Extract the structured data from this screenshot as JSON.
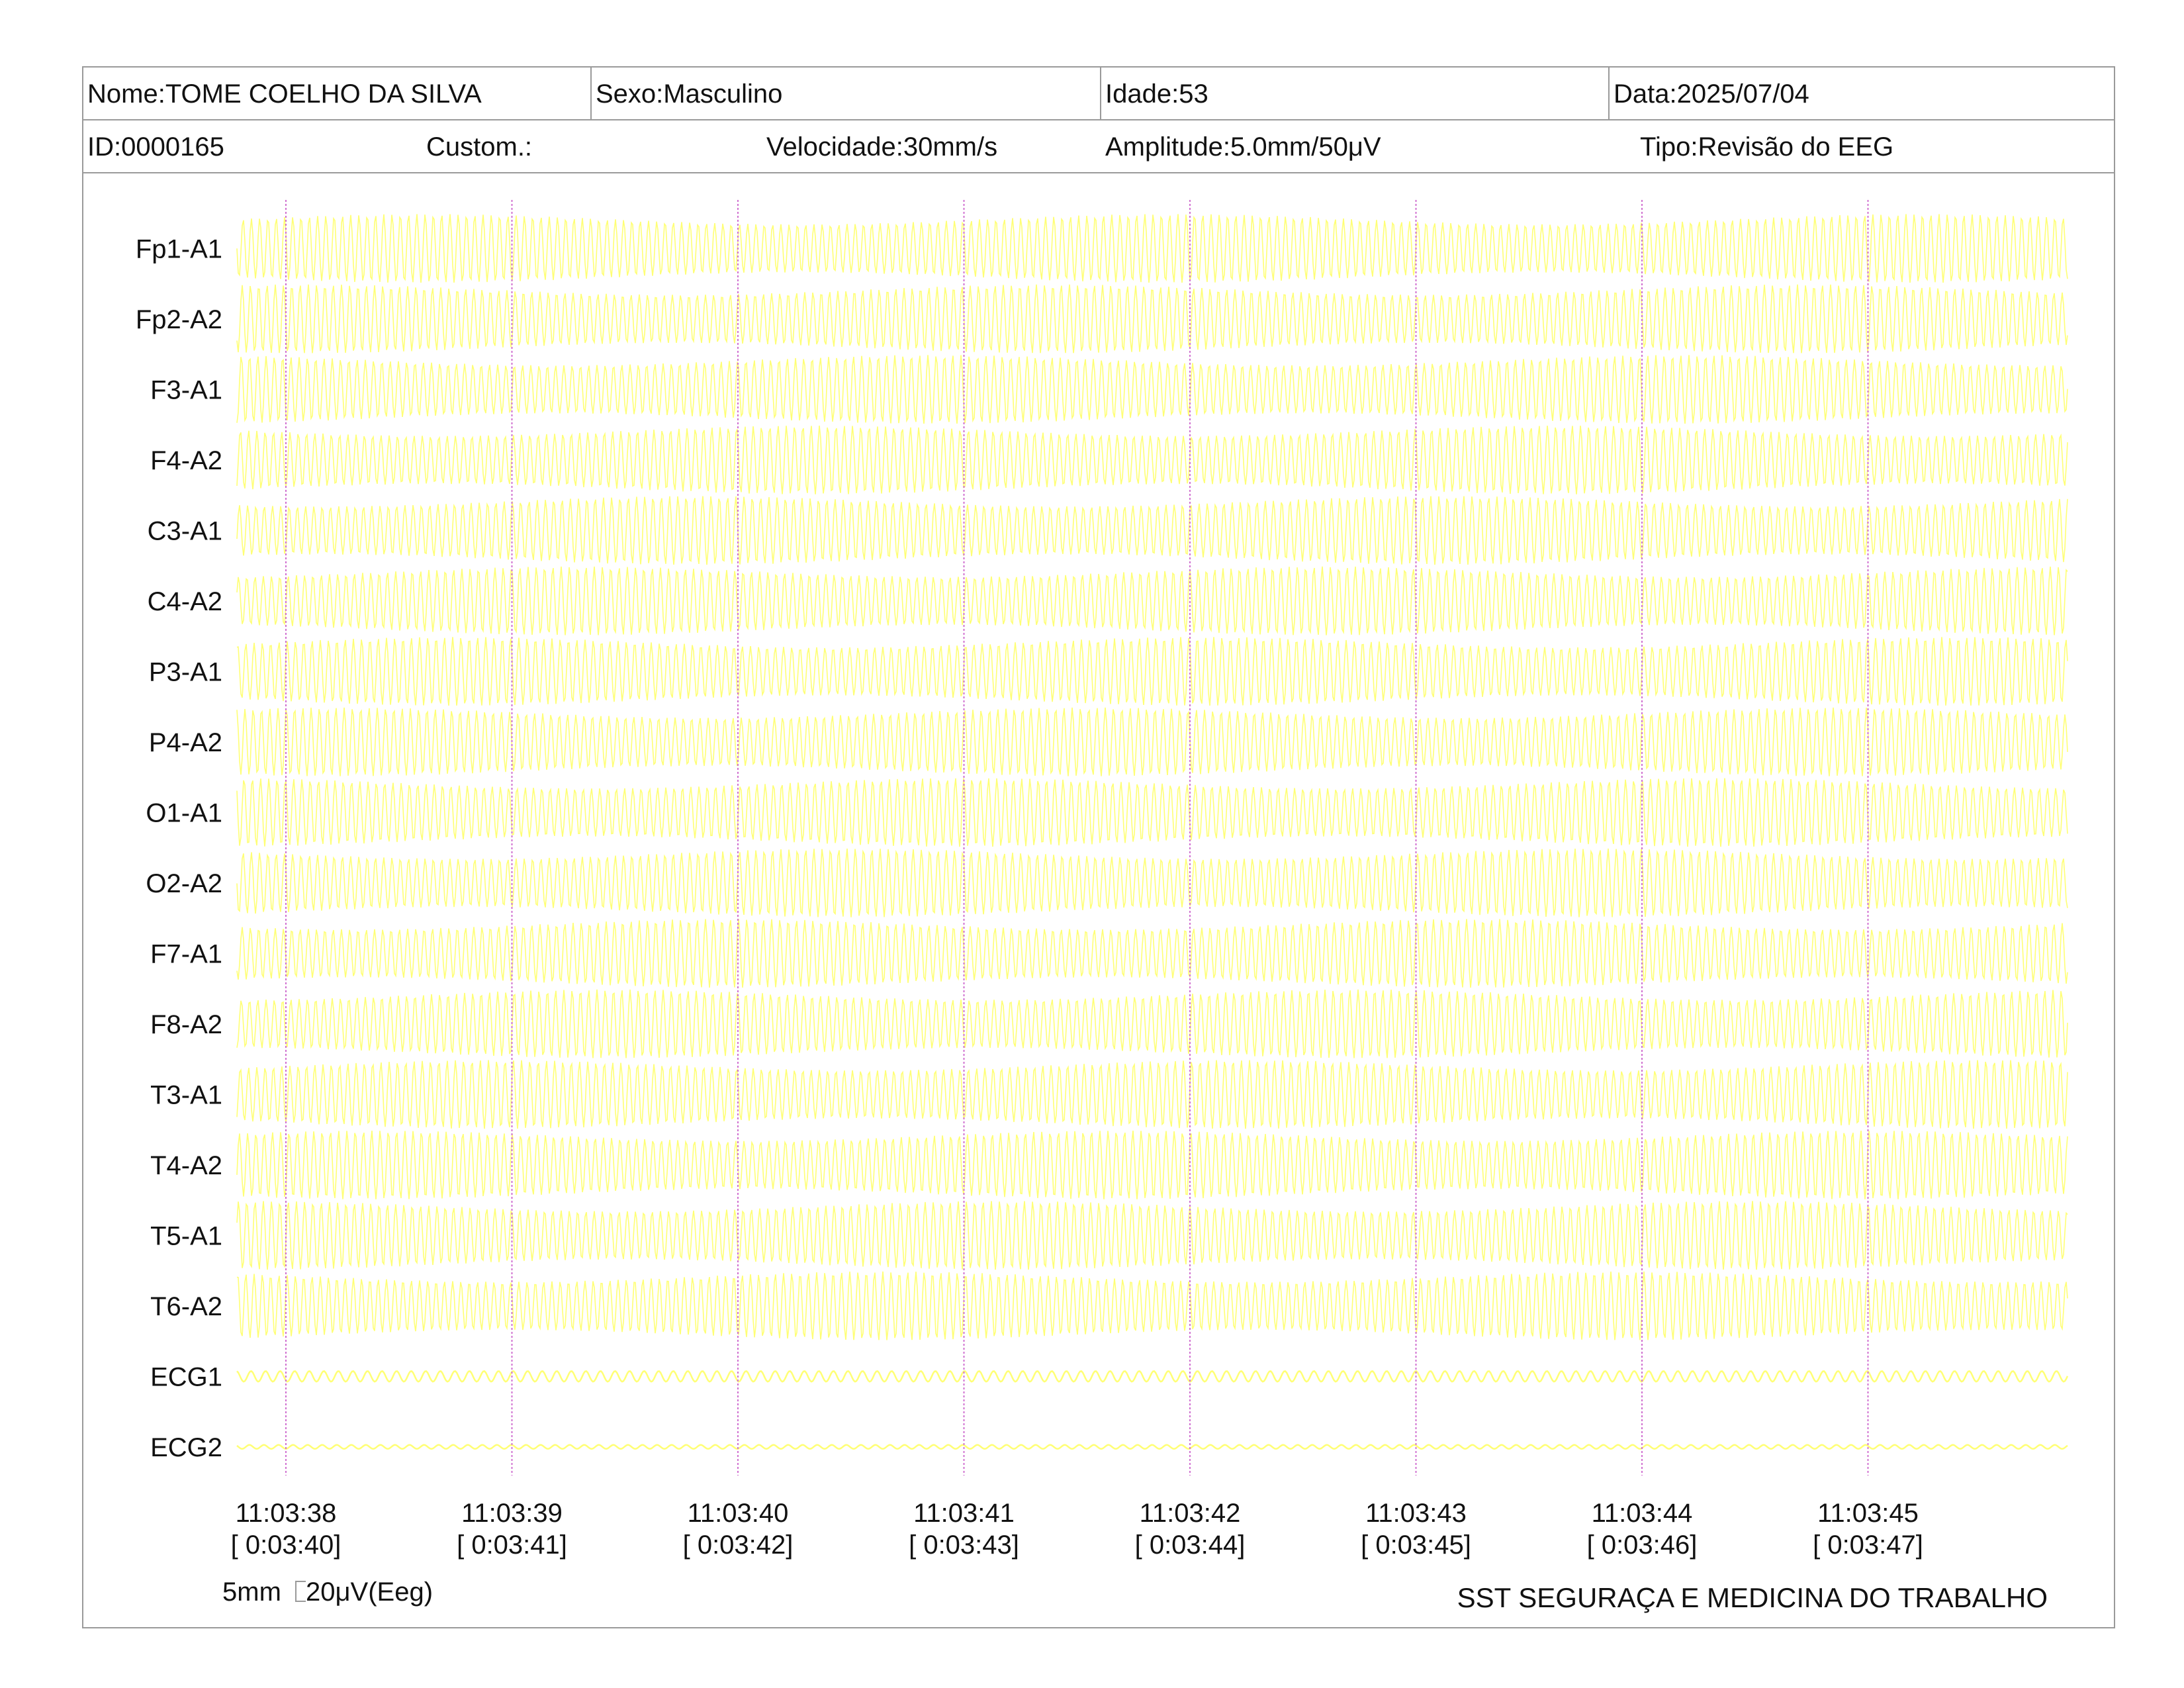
{
  "header": {
    "row1": [
      {
        "key": "name",
        "text": "Nome:TOME COELHO DA SILVA"
      },
      {
        "key": "sex",
        "text": "Sexo:Masculino"
      },
      {
        "key": "age",
        "text": "Idade:53"
      },
      {
        "key": "date",
        "text": "Data:2025/07/04"
      }
    ],
    "row2": [
      {
        "key": "id",
        "text": "ID:0000165"
      },
      {
        "key": "custom",
        "text": "Custom.:"
      },
      {
        "key": "speed",
        "text": "Velocidade:30mm/s"
      },
      {
        "key": "amplitude",
        "text": "Amplitude:5.0mm/50μV"
      },
      {
        "key": "type",
        "text": "Tipo:Revisão do EEG"
      }
    ]
  },
  "channels": [
    "Fp1-A1",
    "Fp2-A2",
    "F3-A1",
    "F4-A2",
    "C3-A1",
    "C4-A2",
    "P3-A1",
    "P4-A2",
    "O1-A1",
    "O2-A2",
    "F7-A1",
    "F8-A2",
    "T3-A1",
    "T4-A2",
    "T5-A1",
    "T6-A2",
    "ECG1",
    "ECG2"
  ],
  "time_markers": [
    {
      "clock": "11:03:38",
      "elapsed": "[ 0:03:40]"
    },
    {
      "clock": "11:03:39",
      "elapsed": "[ 0:03:41]"
    },
    {
      "clock": "11:03:40",
      "elapsed": "[ 0:03:42]"
    },
    {
      "clock": "11:03:41",
      "elapsed": "[ 0:03:43]"
    },
    {
      "clock": "11:03:42",
      "elapsed": "[ 0:03:44]"
    },
    {
      "clock": "11:03:43",
      "elapsed": "[ 0:03:45]"
    },
    {
      "clock": "11:03:44",
      "elapsed": "[ 0:03:46]"
    },
    {
      "clock": "11:03:45",
      "elapsed": "[ 0:03:47]"
    }
  ],
  "calibration": {
    "time_label": "5mm",
    "amp_label": "20μV(Eeg)"
  },
  "footer": {
    "organization": "SST SEGURAÇA E MEDICINA DO TRABALHO"
  },
  "colors": {
    "trace": "#ffff66",
    "marker_line": "#d070d0",
    "border": "#9a9a9a",
    "text": "#111111"
  }
}
